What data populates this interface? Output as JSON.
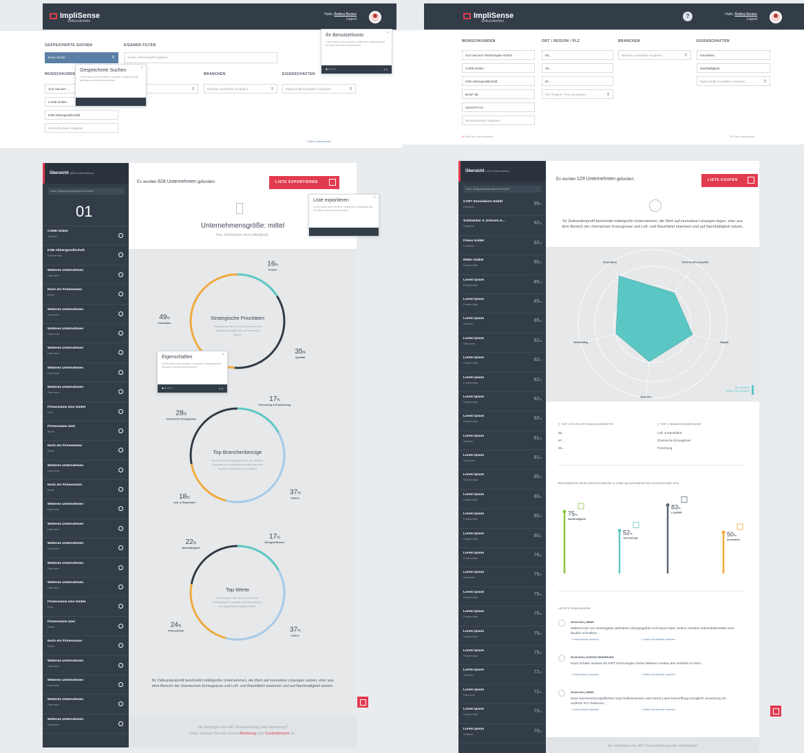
{
  "left": {
    "logo_text": "ImpliSense",
    "logo_sub": "Zielkundenliste",
    "user_greeting": "Hallo,",
    "user_name": "Bettina Becker",
    "logout": "Logout",
    "filter_labels": {
      "saved": "Gespeicherte Suchen",
      "own": "Eigener Filter",
      "wish": "Wunschkunden",
      "branch": "Branchen",
      "props": "Eigenschaften"
    },
    "saved_select": "Neue Suche",
    "own_placeholder": "Suche / Filterbegriff eingeben",
    "wish_items": [
      "ALD Vacuum ...",
      "CARB GmbH",
      "KSB Aktiengesellschaft",
      "Wunschkunden eingeben"
    ],
    "branch_select": "Branche auswählen eingeben",
    "region_select": "... eingeben",
    "props_select": "Eigenschaft auswählen eingeben",
    "filter_reset": "+ Filter zurücksetzen",
    "tip_account": {
      "title": "Ihr Benutzerkonto",
      "text": "Lorem ipsum dolor sit amet, consectetur sadipscing elitr, sed diam nonumy eirmod tempor."
    },
    "tip_saved": {
      "title": "Gespeicherte Suchen",
      "text": "Lorem ipsum dolor sit amet, consetetur sadipscing elitr, sed diam nonumy eirmod tempor."
    },
    "overview_title": "Übersicht",
    "overview_count": "(628 Unternehmen)",
    "sort_label": "Nach Zielgruppenbezogenheit sortiert",
    "first_number": "01",
    "companies": [
      {
        "name": "CARB GmbH",
        "city": "Solbach"
      },
      {
        "name": "KSB Aktiengesellschaft",
        "city": "Frankenthal"
      },
      {
        "name": "Weiteres Unternehmen",
        "city": "Hannover"
      },
      {
        "name": "Noch ein Firmenname",
        "city": "Berlin"
      },
      {
        "name": "Weiteres Unternehmen",
        "city": "Hannover"
      },
      {
        "name": "Weiteres Unternehmen",
        "city": "Hannover"
      },
      {
        "name": "Weiteres Unternehmen",
        "city": "Hannover"
      },
      {
        "name": "Weiteres Unternehmen",
        "city": "Hannover"
      },
      {
        "name": "Weiteres Unternehmen",
        "city": "Hannover"
      },
      {
        "name": "Firmenname eins GmbH",
        "city": "Köln"
      },
      {
        "name": "Firmenname zwei",
        "city": "Berlin"
      },
      {
        "name": "Noch ein Firmenname",
        "city": "Berlin"
      },
      {
        "name": "Weiteres Unternehmen",
        "city": "Hannover"
      },
      {
        "name": "Noch ein Firmenname",
        "city": "Berlin"
      },
      {
        "name": "Weiteres Unternehmen",
        "city": "Hannover"
      },
      {
        "name": "Weiteres Unternehmen",
        "city": "Hannover"
      },
      {
        "name": "Weiteres Unternehmen",
        "city": "Hannover"
      },
      {
        "name": "Weiteres Unternehmen",
        "city": "Hannover"
      },
      {
        "name": "Weiteres Unternehmen",
        "city": "Hannover"
      },
      {
        "name": "Firmenname eins GmbH",
        "city": "Köln"
      },
      {
        "name": "Firmenname zwei",
        "city": "Berlin"
      },
      {
        "name": "Noch ein Firmenname",
        "city": "Berlin"
      },
      {
        "name": "Weiteres Unternehmen",
        "city": "Hannover"
      },
      {
        "name": "Weiteres Unternehmen",
        "city": "Hannover"
      },
      {
        "name": "Weiteres Unternehmen",
        "city": "Hannover"
      },
      {
        "name": "Weiteres Unternehmen",
        "city": "Hannover"
      }
    ],
    "found_prefix": "Es wurden",
    "found_count": "628 Unternehmen",
    "found_suffix": "gefunden",
    "export_btn": "LISTE EXPORTIEREN",
    "tip_export": {
      "title": "Liste exportieren",
      "text": "Lorem ipsum dolor sit amet, consectetur sadipscing elitr, sed diam nonumy eirmod tempor."
    },
    "size_title": "Unternehmensgröße: mittel",
    "size_sub": "Ihre Zielkunden sind mittelgroß.",
    "tip_props": {
      "title": "Eigenschaften",
      "text": "Lorem ipsum dolor sit amet, consectetur sadipscing elitr, sed diam nonumy eirmod tempor."
    },
    "rings": [
      {
        "title": "Strategische Prioritäten",
        "text": "Hinweistexte die, für Ihre Zielkunden eine wichtigste Qualität rolle auf Innovation setzen.",
        "labels": [
          {
            "value": "16",
            "name": "Kosten"
          },
          {
            "value": "35",
            "name": "Qualität"
          },
          {
            "value": "49",
            "name": "Innovation"
          }
        ]
      },
      {
        "title": "Top Branchenbezüge",
        "text": "Die Branchenbezüge geben an, mit welchen Branchen die Unternehmen selbst oder ihre Kunden verflochten zu tun haben.",
        "labels": [
          {
            "value": "17",
            "name": "Forschung & Entwicklung"
          },
          {
            "value": "37",
            "name": "andere"
          },
          {
            "value": "18",
            "name": "Luft- & Raumfahrt"
          },
          {
            "value": "28",
            "name": "Chemische Erzeugnisse"
          }
        ]
      },
      {
        "title": "Top Werte",
        "text": "Unternehmen alle Branchen für eine Nachhaltigkeit Lösungen erkennen lässt an den aufgeführten Eigenschaften.",
        "labels": [
          {
            "value": "17",
            "name": "Energieeffizienz"
          },
          {
            "value": "37",
            "name": "andere"
          },
          {
            "value": "24",
            "name": "Photovoltaik"
          },
          {
            "value": "22",
            "name": "Nachhaltigkeit"
          }
        ]
      }
    ],
    "pct_unit": "%",
    "profile_text": "Ihr Zielkundenprofil beschreibt mittelgroße Unternehmen, die Wert auf innovative Lösungen setzen, eher aus dem Bereich der chemischen Erzeugnisse und Luft- und Raumfahrt stammen und auf Nachhaltigkeit setzen.",
    "footer_q": "Sie benötigen eine API, Konzernlösung oder Monitoring?",
    "footer_pre": "Dann schauen Sie sich unsere",
    "footer_link1": "Abolösung",
    "footer_mid": "oder",
    "footer_link2": "Custombereich",
    "footer_end": "an."
  },
  "right": {
    "logo_text": "ImpliSense",
    "logo_sub": "Zielkundenliste",
    "help": "?",
    "user_greeting": "Hallo,",
    "user_name": "Bettina Becker",
    "logout": "Logout",
    "filter_labels": {
      "wish": "Wunschkunden",
      "region": "Ort / Region / PLZ",
      "branch": "Branchen",
      "props": "Eigenschaften"
    },
    "wish_items": [
      "ALD Vacuum Technologies GmbH",
      "CARB GmbH",
      "KSB Aktiengesellschaft",
      "BASF SE",
      "SCHOTT AG",
      "Wunschkunden eingeben"
    ],
    "region_items": [
      "83...",
      "45...",
      "67...",
      "Ort / Region / PLZ auswählen"
    ],
    "branch_select": "Branche auswählen eingeben",
    "props_items": [
      "Innovation",
      "Nachhaltigkeit",
      "Eigenschaft auswählen eingeben"
    ],
    "all_reset": "Alle Filter zurücksetzen",
    "filter_hide": "Filter ausblenden",
    "overview_title": "Übersicht",
    "overview_count": "(129 Unternehmen)",
    "sort_label": "Nach Zielgruppenbezogenheit sortiert",
    "companies": [
      {
        "name": "CART Innovations GmbH",
        "city": "Frankfurt",
        "pct": "95"
      },
      {
        "name": "Schmücker & Johnsen G...",
        "city": "Frankfurt",
        "pct": "92"
      },
      {
        "name": "Friese GmbH",
        "city": "Frankfurt",
        "pct": "92"
      },
      {
        "name": "Relter GmbH",
        "city": "Frankenthal",
        "pct": "90"
      },
      {
        "name": "Lorem ipsum",
        "city": "Frankenthal",
        "pct": "85"
      },
      {
        "name": "Lorem ipsum",
        "city": "Frankenthal",
        "pct": "85"
      },
      {
        "name": "Lorem ipsum",
        "city": "Solbach",
        "pct": "85"
      },
      {
        "name": "Lorem ipsum",
        "city": "Hannover",
        "pct": "82"
      },
      {
        "name": "Lorem ipsum",
        "city": "Frankenthal",
        "pct": "82"
      },
      {
        "name": "Lorem ipsum",
        "city": "Frankenthal",
        "pct": "82"
      },
      {
        "name": "Lorem ipsum",
        "city": "Frankenthal",
        "pct": "82"
      },
      {
        "name": "Lorem ipsum",
        "city": "Frankenthal",
        "pct": "82"
      },
      {
        "name": "Lorem ipsum",
        "city": "Solbach",
        "pct": "81"
      },
      {
        "name": "Lorem ipsum",
        "city": "Hannover",
        "pct": "81"
      },
      {
        "name": "Lorem ipsum",
        "city": "Frankenthal",
        "pct": "80"
      },
      {
        "name": "Lorem ipsum",
        "city": "Frankenthal",
        "pct": "80"
      },
      {
        "name": "Lorem ipsum",
        "city": "Frankenthal",
        "pct": "80"
      },
      {
        "name": "Lorem ipsum",
        "city": "Frankenthal",
        "pct": "80"
      },
      {
        "name": "Lorem ipsum",
        "city": "Frankenthal",
        "pct": "76"
      },
      {
        "name": "Lorem ipsum",
        "city": "Hannover",
        "pct": "75"
      },
      {
        "name": "Lorem ipsum",
        "city": "Frankenthal",
        "pct": "75"
      },
      {
        "name": "Lorem ipsum",
        "city": "Frankenthal",
        "pct": "75"
      },
      {
        "name": "Lorem ipsum",
        "city": "Frankenthal",
        "pct": "75"
      },
      {
        "name": "Lorem ipsum",
        "city": "Frankenthal",
        "pct": "75"
      },
      {
        "name": "Lorem ipsum",
        "city": "Solbach",
        "pct": "72"
      },
      {
        "name": "Lorem ipsum",
        "city": "Hannover",
        "pct": "72"
      },
      {
        "name": "Lorem ipsum",
        "city": "Frankenthal",
        "pct": "70"
      },
      {
        "name": "Lorem ipsum",
        "city": "Solbach",
        "pct": "70"
      }
    ],
    "pct_unit": "%",
    "found_prefix": "Es wurden",
    "found_count": "129 Unternehmen",
    "found_suffix": "gefunden",
    "buy_btn": "LISTE KAUFEN",
    "profile_text": "Ihr Zielkundenprofil beschreibt mittelgroße Unternehmen, die Wert auf innovative Lösungen legen, eher aus dem Bereich der chemischen Erzeugnisse und Luft- und Raumfahrt stammen und auf Nachhaltigkeit setzen.",
    "radar_axes": [
      "Innovation",
      "Unternehmensgröße",
      "Digital",
      "Branche",
      "Nachhaltig"
    ],
    "radar_caption": [
      "ZIELGRUPPE",
      "IHRER ZIELKUNDEN"
    ],
    "top_plz_title": "TOP 3 POSTLEITZAHLENGEBIETE",
    "top_plz": [
      "65...",
      "67...",
      "55..."
    ],
    "top_branch_title": "TOP 3 BRANCHENBEZÜGE",
    "top_branch": [
      "Luft- & Raumfahrt",
      "Chemische Erzeugnisse",
      "Forschung"
    ],
    "props_title": "BESONDERS HERVORSTECHENDE & IHRE AUSGEWÄHLTEN EIGENSCHAFTEN",
    "props_bars": [
      {
        "value": "75",
        "name": "Nachhaltigkeit",
        "color": "#8dc63f"
      },
      {
        "value": "52",
        "name": "Technologie",
        "color": "#5bc7c4"
      },
      {
        "value": "83",
        "name": "Loyalität",
        "color": "#5b6670"
      },
      {
        "value": "50",
        "name": "Innovation",
        "color": "#f0a93b"
      }
    ],
    "events_title": "LETZTE EREIGNISSE",
    "events": [
      {
        "date": "05.09.2016",
        "type": "NEWS",
        "text": "Während der von Gesetzgeber geförderte Übergangsfrist noch Raum lässt, fordern einzelne Automobilhersteller eine deutlich schnellere ...",
        "link1": "+ Unterschiede ansehen",
        "link2": "+ Artikel auf Website ansehen"
      },
      {
        "date": "06.08.2016",
        "type": "KONTAKTÄNDERUNG",
        "text": "Klaus Schäfer verlässt die KIRT Technologies GmbH Weiteren Ausbau des Vertriebs in Asien...",
        "link1": "+ Unterschiede ansehen",
        "link2": "+ Artikel auf Website ansehen"
      },
      {
        "date": "20.08.2016",
        "type": "NEWS",
        "text": "Neue Kennzeichnungspflichten sorgt Reifenindustrie unter Druck Laser-beschriftung ermöglicht Umsetzung der UN/ECE R17 Reifenvor...",
        "link1": "+ Unterschiede ansehen",
        "link2": "+ Artikel auf Website ansehen"
      }
    ],
    "footer_q": "Sie benötigen eine API, Konzernlösung oder Monitoring?"
  }
}
